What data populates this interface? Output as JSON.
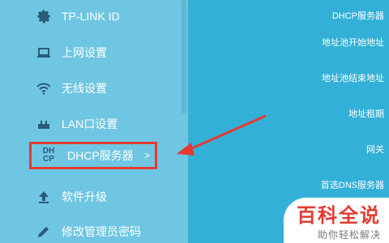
{
  "sidebar": {
    "items": [
      {
        "label": "TP-LINK ID",
        "icon": "gear-icon"
      },
      {
        "label": "上网设置",
        "icon": "laptop-icon"
      },
      {
        "label": "无线设置",
        "icon": "wifi-icon"
      },
      {
        "label": "LAN口设置",
        "icon": "router-icon"
      },
      {
        "label": "DHCP服务器",
        "icon": "dhcp-icon",
        "logo_top": "DH",
        "logo_bottom": "CP",
        "chevron": ">"
      },
      {
        "label": "软件升级",
        "icon": "upload-arrow-icon"
      },
      {
        "label": "修改管理员密码",
        "icon": "pencil-icon"
      }
    ],
    "selected": "DHCP服务器"
  },
  "main": {
    "fields": [
      {
        "label": "DHCP服务器"
      },
      {
        "label": "地址池开始地址"
      },
      {
        "label": "地址池结束地址"
      },
      {
        "label": "地址租期"
      },
      {
        "label": "网关"
      },
      {
        "label": "首选DNS服务器"
      }
    ]
  },
  "watermark": {
    "title": "百科全说",
    "subtitle": "助你轻松解决"
  },
  "colors": {
    "sidebar_bg": "#6fc6e2",
    "main_bg": "#33b0d8",
    "highlight": "#e43a32",
    "icon": "#2b5c79"
  }
}
